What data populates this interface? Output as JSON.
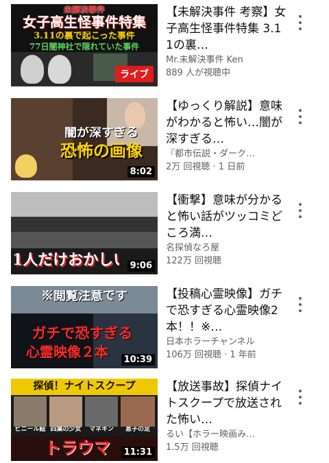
{
  "videos": [
    {
      "title": "【未解決事件 考察】女子高生怪事件特集 3.11の裏…",
      "channel": "Mr.未解決事件 Ken",
      "stats": "889 人が視聴中",
      "badge": "ライブ",
      "thumb_text": [
        "未解決事件",
        "女子高生怪事件特集",
        "3.11の裏で起こった事件",
        "77日闇神社で隠れていた事件"
      ]
    },
    {
      "title": "【ゆっくり解説】意味がわかると怖い…闇が深すぎる…",
      "channel": "『都市伝説・ダーク…",
      "stats": "2万 回視聴 · 1 日前",
      "badge": "8:02",
      "thumb_text": [
        "闇が深すぎる",
        "恐怖の画像"
      ]
    },
    {
      "title": "【衝撃】意味が分かると怖い話がツッコミどころ満…",
      "channel": "名探偵なろ屋",
      "stats": "122万 回視聴",
      "badge": "9:06",
      "thumb_text": [
        "1人だけおかしい"
      ]
    },
    {
      "title": "【投稿心霊映像】ガチで恐すぎる心霊映像2本！！※…",
      "channel": "日本ホラーチャンネル",
      "stats": "106万 回視聴 · 1 年前",
      "badge": "10:39",
      "thumb_text": [
        "※閲覧注意です",
        "ガチで恐すぎる",
        "心霊映像２本"
      ]
    },
    {
      "title": "【放送事故】探偵ナイトスクープで放送された怖い…",
      "channel": "るい【ホラー映画み…",
      "stats": "1.5万 回視聴",
      "badge": "11:31",
      "thumb_text": [
        "探偵！ナイトスクープ",
        "ビニール紐",
        "四葉の少女",
        "マネキン",
        "息子の足",
        "トラウマ"
      ]
    }
  ],
  "colors": {
    "text_primary": "#0f0f0f",
    "text_secondary": "#606060",
    "live_red": "#e21b1b",
    "thumb_red": "#e02020",
    "thumb_yellow": "#ffd400"
  },
  "icons": {
    "menu": "kebab-vertical-icon"
  }
}
